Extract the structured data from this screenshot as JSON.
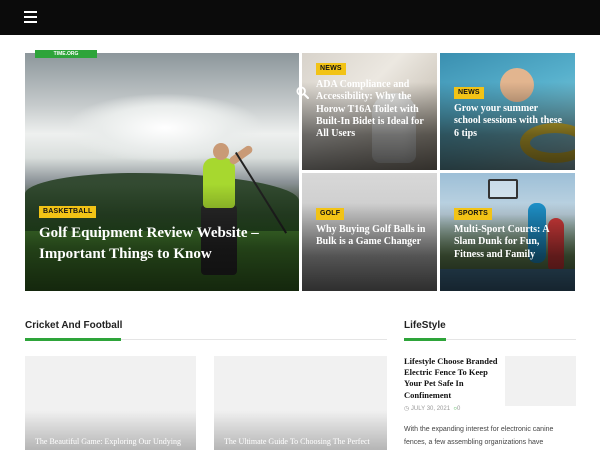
{
  "header": {
    "menu_icon": "hamburger-icon"
  },
  "hero": {
    "tag": "TIME.ORG",
    "category": "BASKETBALL",
    "title": "Golf Equipment Review Website – Important Things to Know"
  },
  "tiles": [
    {
      "category": "NEWS",
      "title": "ADA Compliance and Accessibility: Why the Horow T16A Toilet with Built-In Bidet is Ideal for All Users"
    },
    {
      "category": "NEWS",
      "title": "Grow your summer school sessions with these 6 tips"
    },
    {
      "category": "GOLF",
      "title": "Why Buying Golf Balls in Bulk is a Game Changer"
    },
    {
      "category": "SPORTS",
      "title": "Multi-Sport Courts: A Slam Dunk for Fun, Fitness and Family"
    }
  ],
  "sections": {
    "cricket": {
      "heading": "Cricket And Football",
      "cards": [
        {
          "title": "The Beautiful Game: Exploring Our Undying Love for Football"
        },
        {
          "title": "The Ultimate Guide To Choosing The Perfect Bike Rack for SUV"
        }
      ]
    },
    "lifestyle": {
      "heading": "LifeStyle",
      "post": {
        "title": "Lifestyle Choose Branded Electric Fence To Keep Your Pet Safe In Confinement",
        "date": "JULY 30, 2021",
        "comments": "0",
        "excerpt": "With the expanding interest for electronic canine fences, a few assembling organizations have"
      }
    }
  },
  "colors": {
    "accent": "#2ea43a",
    "badge": "#f2c316",
    "topbar": "#0b0b0b"
  }
}
